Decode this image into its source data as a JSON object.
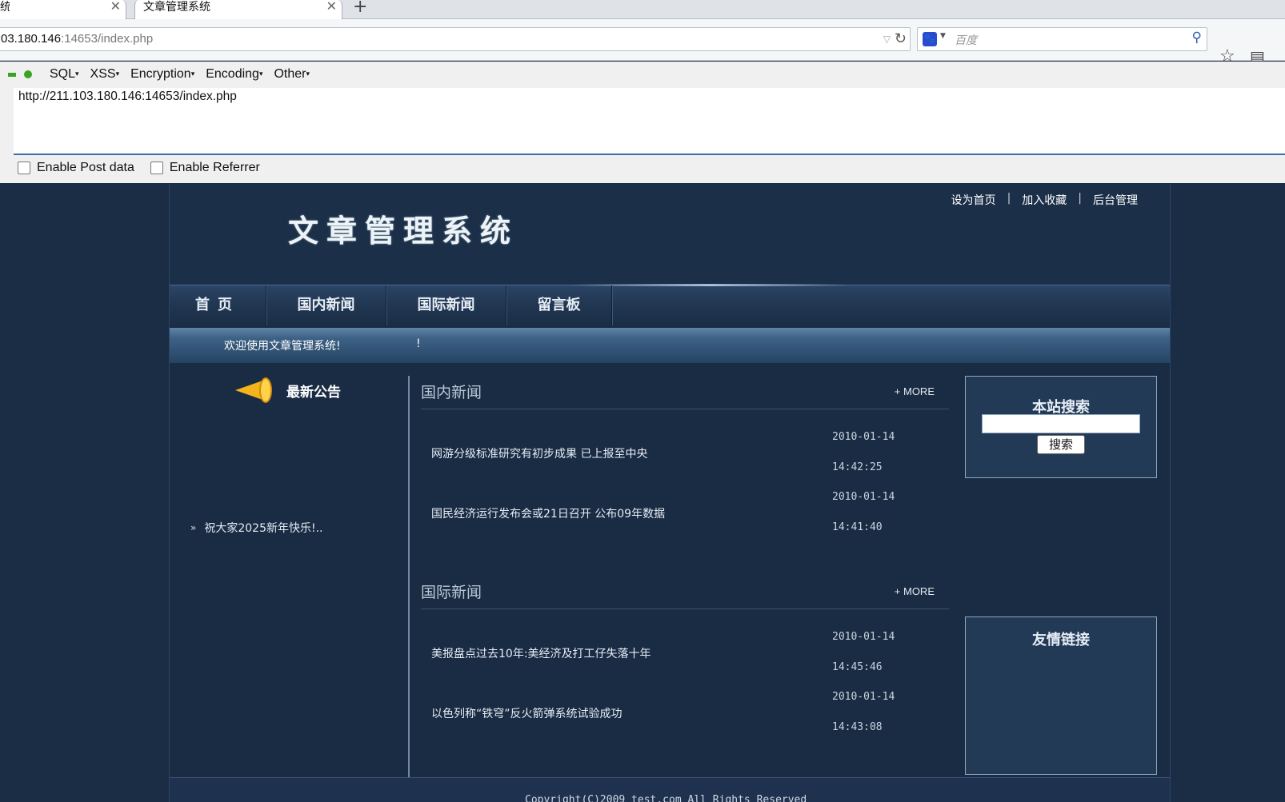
{
  "browser": {
    "tabs": [
      {
        "title": "统"
      },
      {
        "title": "文章管理系统"
      }
    ],
    "url": {
      "host": "03.180.146",
      "path": ":14653/index.php"
    },
    "search": {
      "placeholder": "百度"
    }
  },
  "hackbar": {
    "menu": [
      "SQL",
      "XSS",
      "Encryption",
      "Encoding",
      "Other"
    ],
    "url_value": "http://211.103.180.146:14653/index.php",
    "options": [
      "Enable Post data",
      "Enable Referrer"
    ]
  },
  "site": {
    "toplinks": [
      "设为首页",
      "加入收藏",
      "后台管理"
    ],
    "logo": "文章管理系统",
    "nav": [
      "首页",
      "国内新闻",
      "国际新闻",
      "留言板"
    ],
    "welcome": "欢迎使用文章管理系统!",
    "welcome_extra": "!",
    "notice": {
      "title": "最新公告",
      "items": [
        "祝大家2025新年快乐!.."
      ]
    },
    "sections": [
      {
        "title": "国内新闻",
        "more": "+ MORE",
        "items": [
          {
            "title": "网游分级标准研究有初步成果 已上报至中央",
            "date": "2010-01-14",
            "time": "14:42:25"
          },
          {
            "title": "国民经济运行发布会或21日召开 公布09年数据",
            "date": "2010-01-14",
            "time": "14:41:40"
          }
        ]
      },
      {
        "title": "国际新闻",
        "more": "+ MORE",
        "items": [
          {
            "title": "美报盘点过去10年:美经济及打工仔失落十年",
            "date": "2010-01-14",
            "time": "14:45:46"
          },
          {
            "title": "以色列称“铁穹”反火箭弹系统试验成功",
            "date": "2010-01-14",
            "time": "14:43:08"
          }
        ]
      }
    ],
    "search_box": {
      "title": "本站搜索",
      "button": "搜索"
    },
    "links_box": {
      "title": "友情链接"
    },
    "footer": "Copyright(C)2009 test.com All Rights Reserved"
  }
}
